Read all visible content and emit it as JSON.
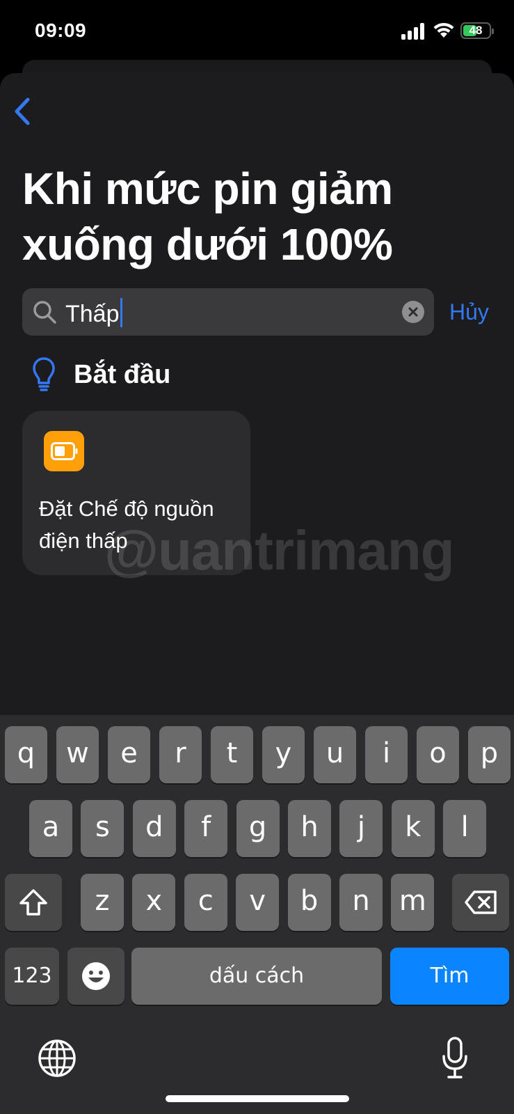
{
  "status_bar": {
    "time": "09:09",
    "battery_level": "48",
    "battery_fraction": 0.48
  },
  "header": {
    "title": "Khi mức pin giảm xuống dưới 100%"
  },
  "search": {
    "value": "Thấp",
    "cancel_label": "Hủy"
  },
  "section": {
    "title": "Bắt đầu"
  },
  "action_card": {
    "label": "Đặt Chế độ nguồn điện thấp",
    "icon": "battery-icon",
    "icon_color": "#ff9f0a"
  },
  "watermark": {
    "text": "@uantrimang"
  },
  "keyboard": {
    "row1": [
      "q",
      "w",
      "e",
      "r",
      "t",
      "y",
      "u",
      "i",
      "o",
      "p"
    ],
    "row2": [
      "a",
      "s",
      "d",
      "f",
      "g",
      "h",
      "j",
      "k",
      "l"
    ],
    "row3": [
      "z",
      "x",
      "c",
      "v",
      "b",
      "n",
      "m"
    ],
    "numbers_label": "123",
    "space_label": "dấu cách",
    "return_label": "Tìm",
    "shift_icon": "shift-icon",
    "delete_icon": "delete-icon",
    "emoji_icon": "emoji-icon",
    "globe_icon": "globe-icon",
    "mic_icon": "microphone-icon"
  },
  "colors": {
    "accent": "#3478f6",
    "sheet_bg": "#1c1c1e",
    "return_key": "#0a84ff"
  }
}
